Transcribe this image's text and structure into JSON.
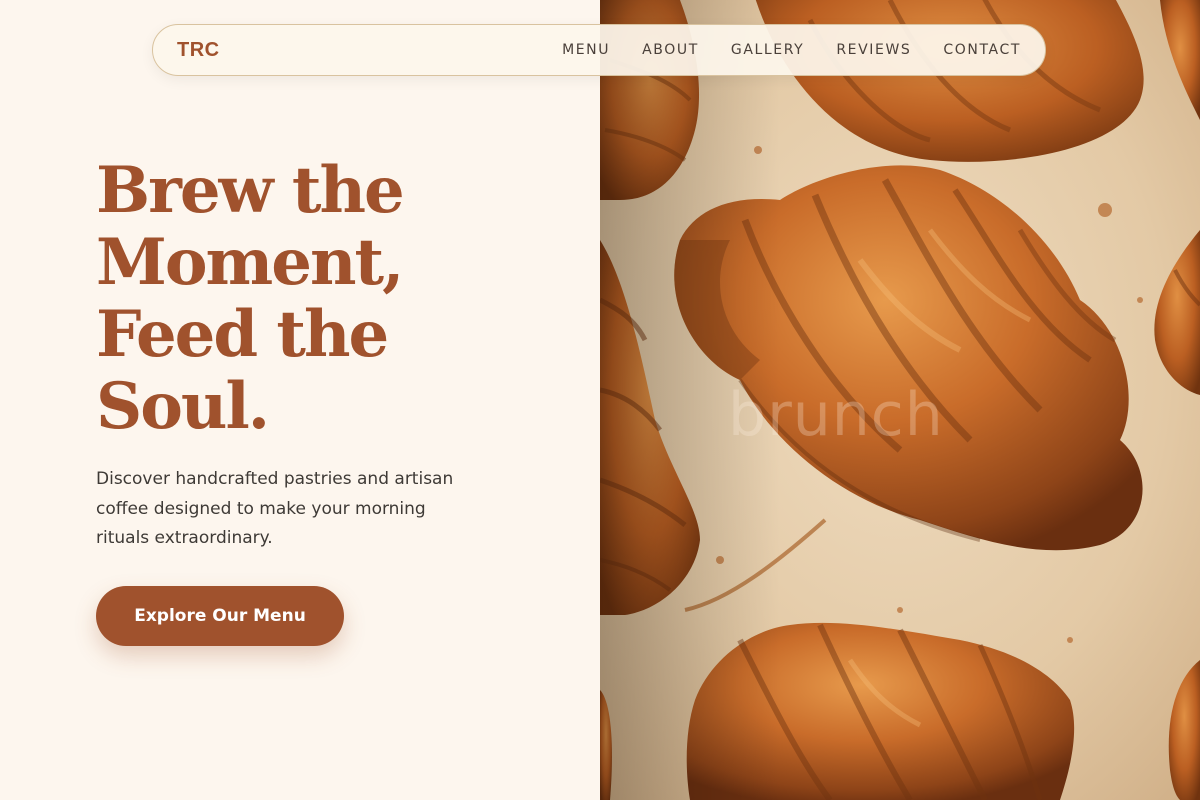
{
  "brand": {
    "logo": "TRC"
  },
  "nav": {
    "items": [
      {
        "label": "MENU"
      },
      {
        "label": "ABOUT"
      },
      {
        "label": "GALLERY"
      },
      {
        "label": "REVIEWS"
      },
      {
        "label": "CONTACT"
      }
    ]
  },
  "hero": {
    "title_lines": [
      "Brew the",
      "Moment,",
      "Feed the",
      "Soul."
    ],
    "subtitle_lines": [
      "Discover handcrafted pastries and artisan",
      "coffee designed to make your morning",
      "rituals extraordinary."
    ],
    "cta_label": "Explore Our Menu",
    "image_watermark": "brunch"
  },
  "colors": {
    "accent": "#a0522d",
    "background": "#fdf6ee",
    "body_text": "#3e3a36",
    "nav_text": "#4a403a",
    "nav_border": "#d9c39f",
    "pastry_gold": "#c26a2a",
    "parchment": "#e8d3b6"
  }
}
